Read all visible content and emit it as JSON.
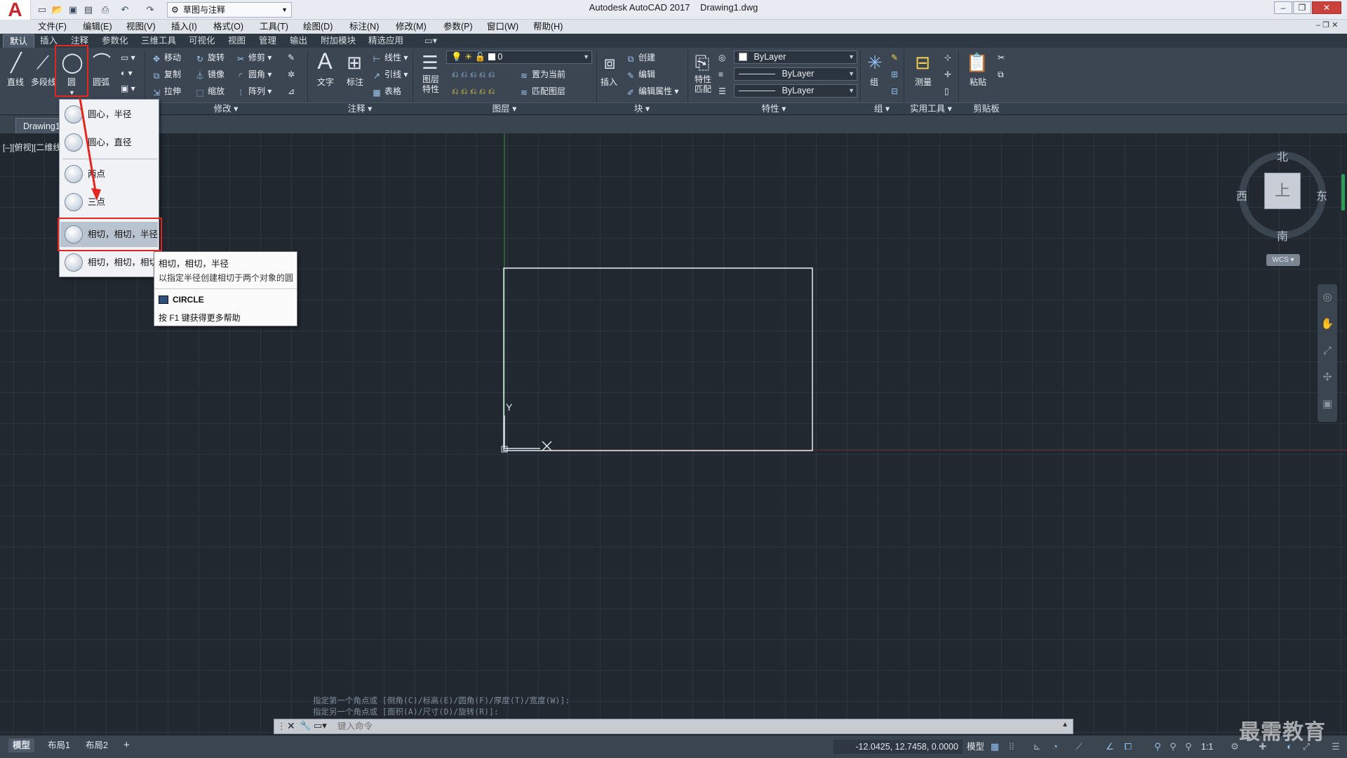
{
  "titlebar": {
    "app_name": "Autodesk AutoCAD 2017",
    "document": "Drawing1.dwg",
    "workspace": "草图与注释",
    "logo": "A"
  },
  "menubar": [
    "文件(F)",
    "编辑(E)",
    "视图(V)",
    "插入(I)",
    "格式(O)",
    "工具(T)",
    "绘图(D)",
    "标注(N)",
    "修改(M)",
    "参数(P)",
    "窗口(W)",
    "帮助(H)"
  ],
  "ribbon_tabs": [
    "默认",
    "插入",
    "注释",
    "参数化",
    "三维工具",
    "可视化",
    "视图",
    "管理",
    "输出",
    "附加模块",
    "精选应用"
  ],
  "ribbon": {
    "draw": {
      "line": "直线",
      "polyline": "多段线",
      "circle": "圆",
      "arc": "圆弧"
    },
    "modify": {
      "move": "移动",
      "rotate": "旋转",
      "trim": "修剪",
      "copy": "复制",
      "mirror": "镜像",
      "fillet": "圆角",
      "stretch": "拉伸",
      "scale": "缩放",
      "array": "阵列",
      "panel": "修改"
    },
    "annotation": {
      "text": "文字",
      "dimension": "标注",
      "linear": "线性",
      "leader": "引线",
      "table": "表格",
      "panel": "注释"
    },
    "layers": {
      "layer_properties": "图层\n特性",
      "layer_name": "0",
      "set_current": "置为当前",
      "match_layer": "匹配图层",
      "panel": "图层"
    },
    "block": {
      "insert": "插入",
      "create": "创建",
      "edit": "编辑",
      "edit_attributes": "编辑属性",
      "panel": "块"
    },
    "properties": {
      "match": "特性\n匹配",
      "color": "ByLayer",
      "linetype": "ByLayer",
      "lineweight": "ByLayer",
      "panel": "特性"
    },
    "groups": {
      "group": "组",
      "panel": "组"
    },
    "utilities": {
      "measure": "测量",
      "panel": "实用工具"
    },
    "clipboard": {
      "paste": "粘贴",
      "panel": "剪贴板"
    }
  },
  "file_tab": "Drawing1",
  "viewport_label": "[–][俯视][二维线",
  "circle_dropdown": {
    "items": [
      "圆心，半径",
      "圆心，直径",
      "两点",
      "三点",
      "相切，相切，半径",
      "相切，相切，相切"
    ]
  },
  "tooltip": {
    "title": "相切，相切，半径",
    "description": "以指定半径创建相切于两个对象的圆",
    "command": "CIRCLE",
    "help": "按 F1 键获得更多帮助"
  },
  "viewcube": {
    "north": "北",
    "south": "南",
    "east": "东",
    "west": "西",
    "face": "上",
    "wcs": "WCS"
  },
  "ucs": {
    "x": "X",
    "y": "Y"
  },
  "command": {
    "history": [
      "指定第一个角点或 [倒角(C)/标高(E)/圆角(F)/厚度(T)/宽度(W)]:",
      "指定另一个角点或 [面积(A)/尺寸(D)/旋转(R)]:"
    ],
    "placeholder": "键入命令"
  },
  "status": {
    "layout_tabs": [
      "模型",
      "布局1",
      "布局2"
    ],
    "coordinates": "-12.0425, 12.7458, 0.0000",
    "space": "模型",
    "scale": "1:1"
  },
  "watermark": "最需教育",
  "colors": {
    "highlight_red": "#e3261f",
    "canvas": "#212830",
    "ribbon": "#3c4653"
  }
}
